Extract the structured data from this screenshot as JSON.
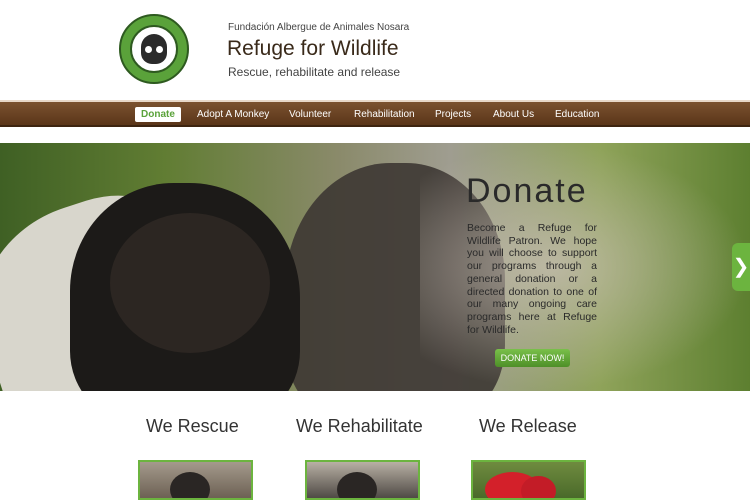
{
  "header": {
    "org_name": "Fundación Albergue de Animales Nosara",
    "site_title": "Refuge for Wildlife",
    "tagline": "Rescue, rehabilitate and release"
  },
  "nav": {
    "items": [
      {
        "label": "Donate",
        "active": true
      },
      {
        "label": "Adopt A Monkey",
        "active": false
      },
      {
        "label": "Volunteer",
        "active": false
      },
      {
        "label": "Rehabilitation",
        "active": false
      },
      {
        "label": "Projects",
        "active": false
      },
      {
        "label": "About Us",
        "active": false
      },
      {
        "label": "Education",
        "active": false
      }
    ]
  },
  "hero": {
    "title": "Donate",
    "text": "Become a Refuge for Wildlife Patron. We hope you will choose to support our programs through a general donation or a directed donation to one of our many ongoing care programs here at Refuge for Wildlife.",
    "button_label": "DONATE NOW!",
    "next_icon": "chevron-right-icon",
    "next_glyph": "❯"
  },
  "features": [
    {
      "title": "We Rescue"
    },
    {
      "title": "We Rehabilitate"
    },
    {
      "title": "We Release"
    }
  ],
  "colors": {
    "brand_green": "#6cb43f",
    "nav_brown": "#6b4324"
  }
}
